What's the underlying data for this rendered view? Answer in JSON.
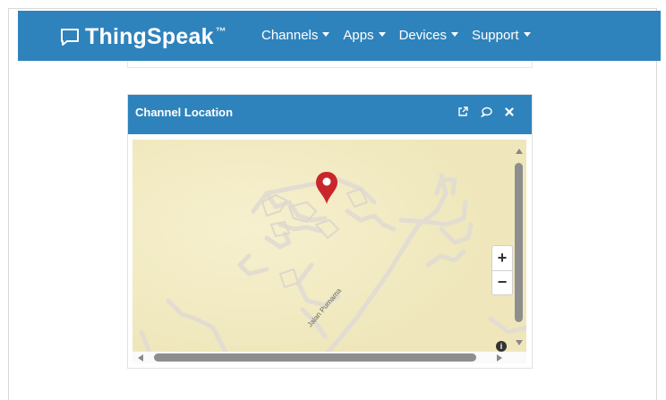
{
  "navbar": {
    "brand": "ThingSpeak",
    "brand_tm": "™",
    "brand_icon": "chat-bubble-icon",
    "items": [
      {
        "label": "Channels"
      },
      {
        "label": "Apps"
      },
      {
        "label": "Devices"
      },
      {
        "label": "Support"
      }
    ],
    "color": "#2f83bc"
  },
  "widget": {
    "title": "Channel Location",
    "tools": [
      "external-link-icon",
      "comment-icon",
      "close-icon"
    ]
  },
  "map": {
    "street_label": "Jalan Purnama",
    "zoom_in": "+",
    "zoom_out": "−",
    "info": "i",
    "background": "#f3ecc5",
    "marker_color": "#c9262b"
  }
}
